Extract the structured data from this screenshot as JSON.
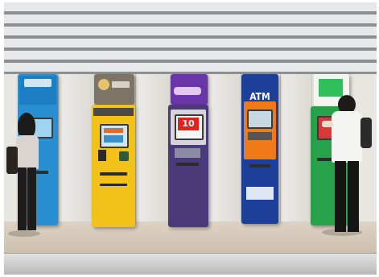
{
  "scene": {
    "description_colors": {
      "ceiling_light": "#e7e8ea",
      "ceiling_dark": "#8d9093",
      "wall": "#e8e6e1",
      "floor": "#d6c9b8"
    }
  },
  "atms": [
    {
      "color": "#2a8fd0",
      "header_color": "#1c7fc4"
    },
    {
      "color": "#f2c21a",
      "header_color": "#7d7466"
    },
    {
      "color": "#4a3a7a",
      "header_color": "#6a35a8",
      "badge_text": "10"
    },
    {
      "color": "#1c3f9a",
      "header_color": "#1c3f9a",
      "header_text": "ATM",
      "body_accent": "#f07a18"
    },
    {
      "color": "#27a24a",
      "header_color": "#2fbf5a"
    }
  ]
}
